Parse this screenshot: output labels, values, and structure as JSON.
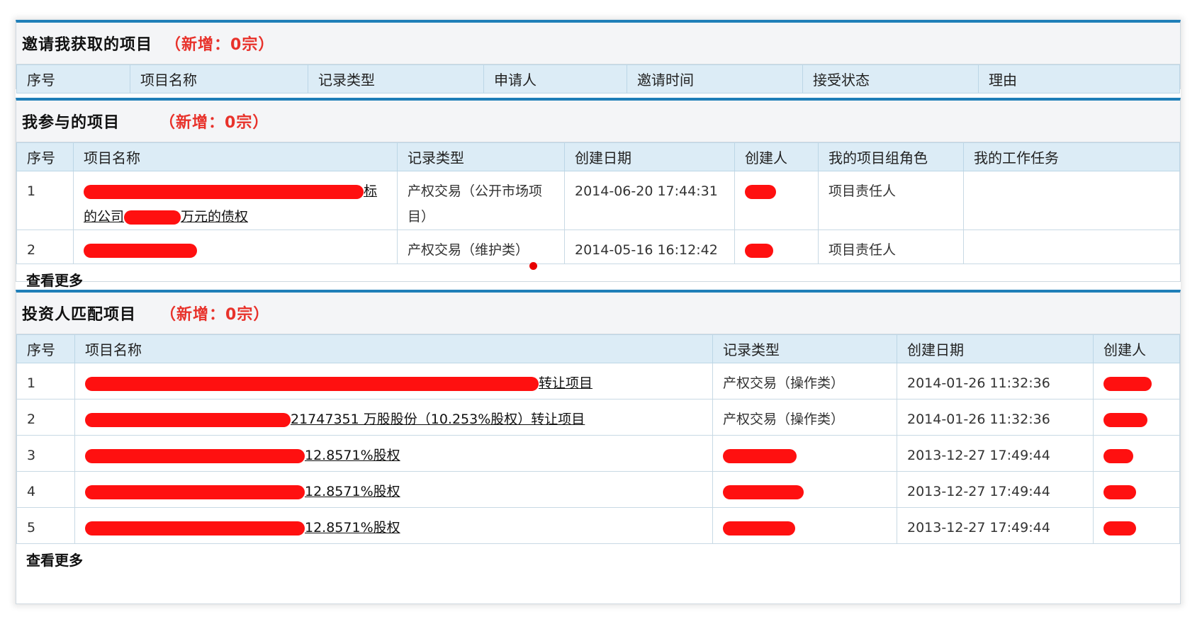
{
  "invite": {
    "title": "邀请我获取的项目",
    "badge": "（新增：0宗）",
    "headers": [
      "序号",
      "项目名称",
      "记录类型",
      "申请人",
      "邀请时间",
      "接受状态",
      "理由"
    ]
  },
  "participate": {
    "title": "我参与的项目",
    "badge": "（新增：0宗）",
    "headers": [
      "序号",
      "项目名称",
      "记录类型",
      "创建日期",
      "创建人",
      "我的项目组角色",
      "我的工作任务"
    ],
    "rows": [
      {
        "no": "1",
        "name_line1_suffix": "标",
        "name_line2_prefix": "的公司",
        "name_line2_suffix": "万元的债权",
        "type": "产权交易（公开市场项目）",
        "date": "2014-06-20 17:44:31",
        "role": "项目责任人",
        "task": ""
      },
      {
        "no": "2",
        "type": "产权交易（维护类）",
        "date": "2014-05-16 16:12:42",
        "role": "项目责任人",
        "task": ""
      }
    ],
    "more": "查看更多"
  },
  "investor": {
    "title": "投资人匹配项目",
    "badge": "（新增：0宗）",
    "headers": [
      "序号",
      "项目名称",
      "记录类型",
      "创建日期",
      "创建人"
    ],
    "rows": [
      {
        "no": "1",
        "name_suffix": "转让项目",
        "type": "产权交易（操作类）",
        "date": "2014-01-26 11:32:36"
      },
      {
        "no": "2",
        "name_suffix": "21747351 万股股份（10.253%股权）转让项目",
        "type": "产权交易（操作类）",
        "date": "2014-01-26 11:32:36"
      },
      {
        "no": "3",
        "name_suffix": "12.8571%股权",
        "type": "",
        "date": "2013-12-27 17:49:44"
      },
      {
        "no": "4",
        "name_suffix": "12.8571%股权",
        "type": "",
        "date": "2013-12-27 17:49:44"
      },
      {
        "no": "5",
        "name_suffix": "12.8571%股权",
        "type": "",
        "date": "2013-12-27 17:49:44"
      }
    ],
    "more": "查看更多"
  }
}
